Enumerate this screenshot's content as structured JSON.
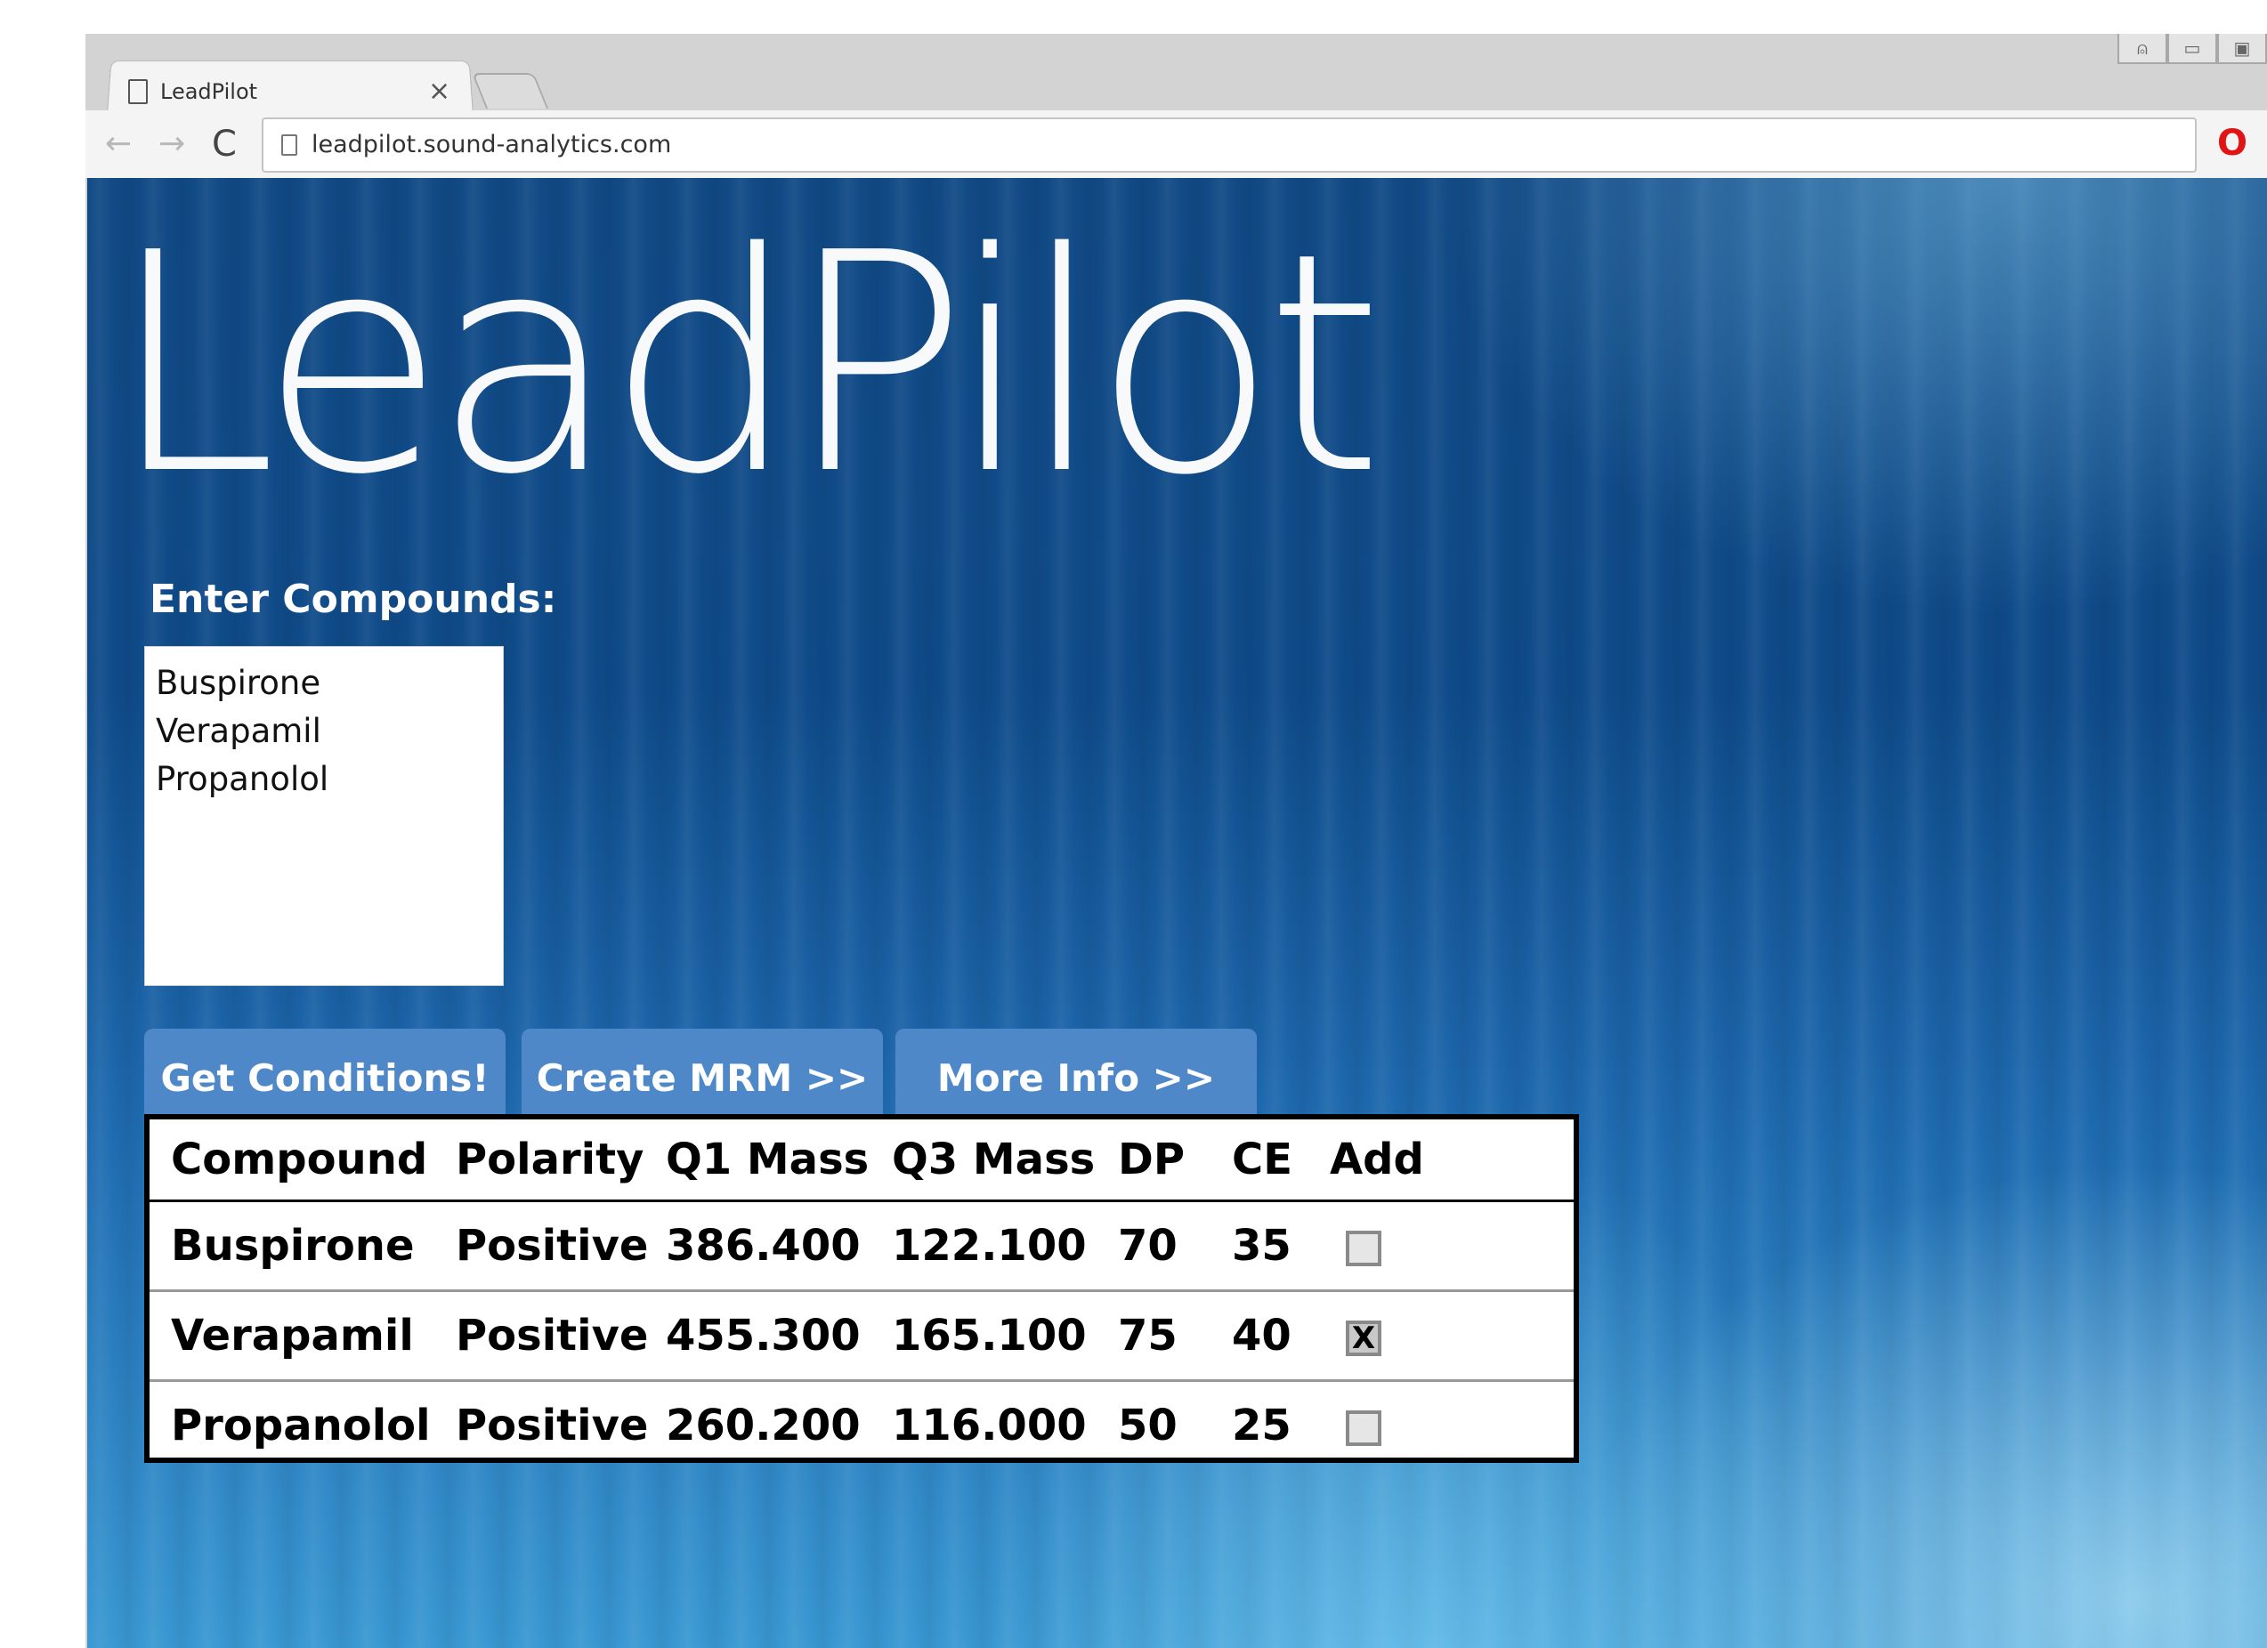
{
  "browser": {
    "tab_title": "LeadPilot",
    "tab_close": "×",
    "url": "leadpilot.sound-analytics.com",
    "back": "←",
    "forward": "→",
    "reload": "C",
    "opera": "O"
  },
  "page": {
    "logo": "LeadPilot",
    "enter_label": "Enter Compounds:",
    "compounds_text": "Buspirone\nVerapamil\nPropanolol"
  },
  "buttons": {
    "get_conditions": "Get Conditions!",
    "create_mrm": "Create MRM >>",
    "more_info": "More Info >>"
  },
  "table": {
    "headers": [
      "Compound",
      "Polarity",
      "Q1 Mass",
      "Q3 Mass",
      "DP",
      "CE",
      "Add"
    ],
    "rows": [
      {
        "compound": "Buspirone",
        "polarity": "Positive",
        "q1": "386.400",
        "q3": "122.100",
        "dp": "70",
        "ce": "35",
        "add": ""
      },
      {
        "compound": "Verapamil",
        "polarity": "Positive",
        "q1": "455.300",
        "q3": "165.100",
        "dp": "75",
        "ce": "40",
        "add": "X"
      },
      {
        "compound": "Propanolol",
        "polarity": "Positive",
        "q1": "260.200",
        "q3": "116.000",
        "dp": "50",
        "ce": "25",
        "add": ""
      }
    ]
  },
  "colors": {
    "button_bg": "#4f88c8",
    "background_top": "#114a85",
    "background_bottom": "#3a98d2",
    "opera_red": "#e01414"
  }
}
